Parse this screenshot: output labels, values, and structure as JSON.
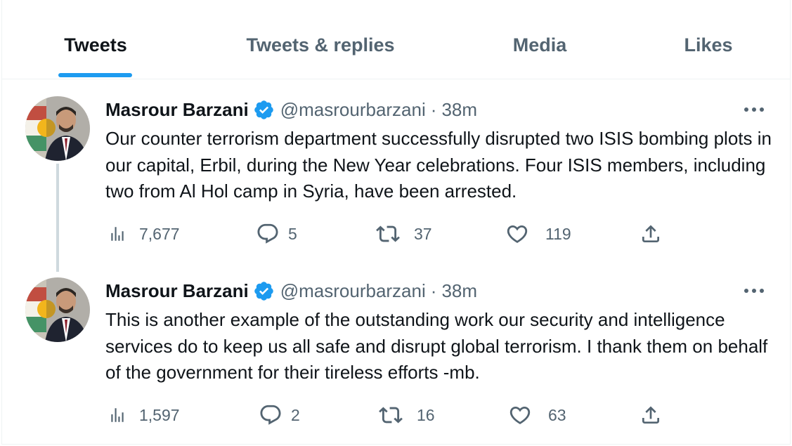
{
  "tabs": [
    {
      "label": "Tweets",
      "active": true
    },
    {
      "label": "Tweets & replies",
      "active": false
    },
    {
      "label": "Media",
      "active": false
    },
    {
      "label": "Likes",
      "active": false
    }
  ],
  "colors": {
    "accent": "#1d9bf0",
    "text_primary": "#0f1419",
    "text_secondary": "#536471",
    "divider": "#eff3f4",
    "thread_line": "#cfd9de"
  },
  "tweets": [
    {
      "author": {
        "display_name": "Masrour Barzani",
        "handle": "@masrourbarzani",
        "verified": true
      },
      "separator": "·",
      "time": "38m",
      "text": "Our counter terrorism department successfully disrupted two ISIS bombing plots in our capital, Erbil, during the New Year celebrations. Four ISIS members, including two from Al Hol camp in Syria, have been arrested.",
      "stats": {
        "views": "7,677",
        "replies": "5",
        "retweets": "37",
        "likes": "119"
      }
    },
    {
      "author": {
        "display_name": "Masrour Barzani",
        "handle": "@masrourbarzani",
        "verified": true
      },
      "separator": "·",
      "time": "38m",
      "text": "This is another example of the outstanding work our security and intelligence services do to keep us all safe and disrupt global terrorism. I thank them on behalf of the government for their tireless efforts -mb.",
      "stats": {
        "views": "1,597",
        "replies": "2",
        "retweets": "16",
        "likes": "63"
      }
    }
  ]
}
